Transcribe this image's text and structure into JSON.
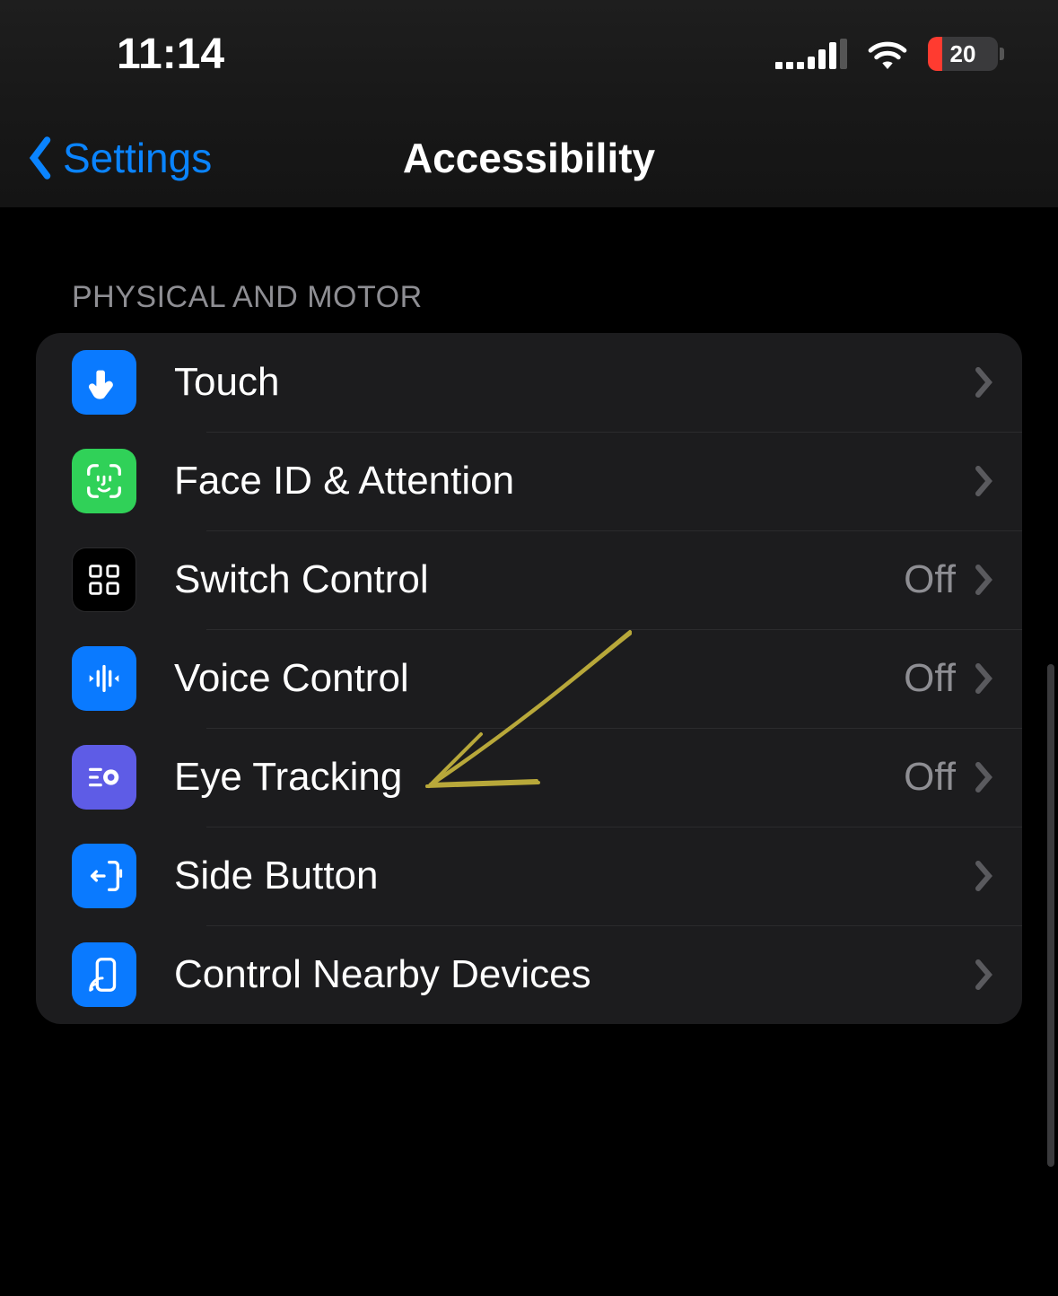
{
  "status_bar": {
    "time": "11:14",
    "battery_percent": "20"
  },
  "nav": {
    "back_label": "Settings",
    "title": "Accessibility"
  },
  "section": {
    "header": "PHYSICAL AND MOTOR",
    "items": [
      {
        "icon": "touch-icon",
        "icon_bg": "blue",
        "label": "Touch",
        "value": ""
      },
      {
        "icon": "faceid-icon",
        "icon_bg": "green",
        "label": "Face ID & Attention",
        "value": ""
      },
      {
        "icon": "switch-control-icon",
        "icon_bg": "black",
        "label": "Switch Control",
        "value": "Off"
      },
      {
        "icon": "voice-control-icon",
        "icon_bg": "blue",
        "label": "Voice Control",
        "value": "Off"
      },
      {
        "icon": "eye-tracking-icon",
        "icon_bg": "purple",
        "label": "Eye Tracking",
        "value": "Off"
      },
      {
        "icon": "side-button-icon",
        "icon_bg": "blue",
        "label": "Side Button",
        "value": ""
      },
      {
        "icon": "nearby-devices-icon",
        "icon_bg": "blue",
        "label": "Control Nearby Devices",
        "value": ""
      }
    ]
  }
}
